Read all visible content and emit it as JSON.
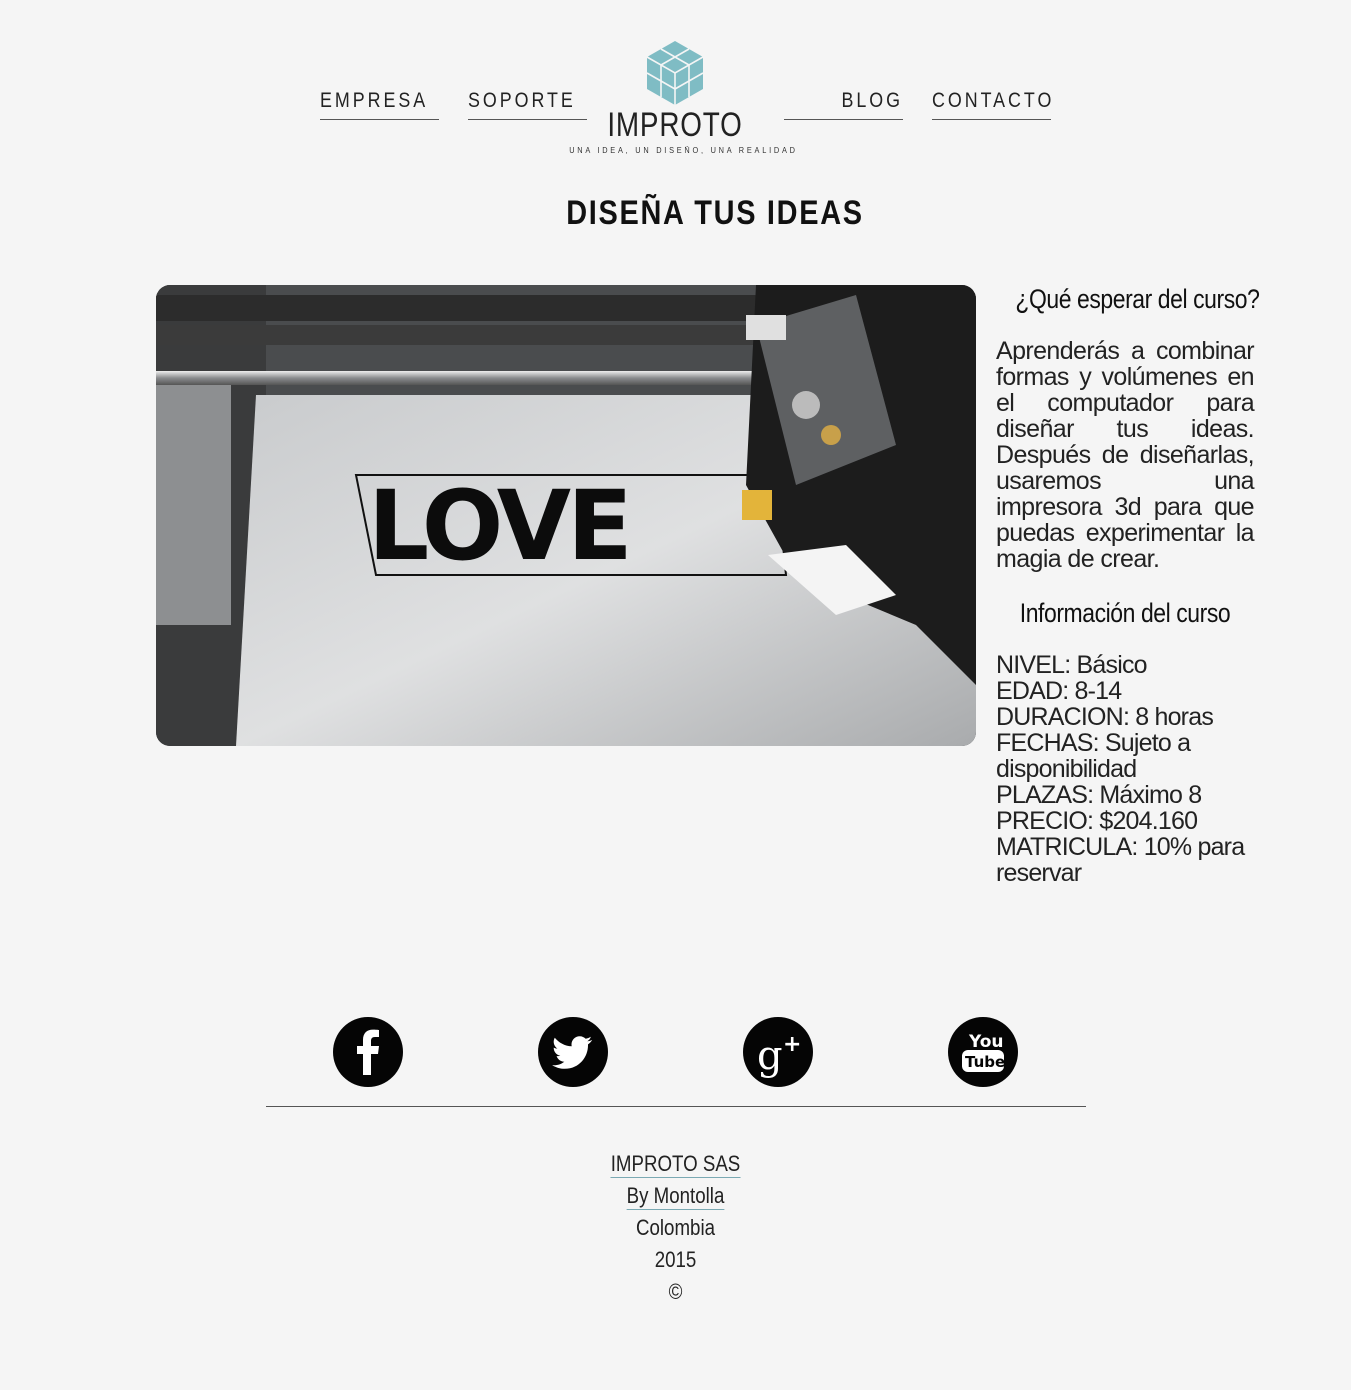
{
  "nav": {
    "empresa": "EMPRESA",
    "soporte": "SOPORTE",
    "blog": "BLOG",
    "contacto": "CONTACTO"
  },
  "logo": {
    "name": "IMPROTO",
    "tagline": "UNA IDEA, UN DISEÑO, UNA REALIDAD",
    "color": "#7fbcc4"
  },
  "page_title": "DISEÑA TUS IDEAS",
  "photo": {
    "subject": "LOVE"
  },
  "sidebar": {
    "expect_title": "¿Qué esperar del curso?",
    "expect_text": "Aprenderás a combinar formas y volúmenes en el computador para diseñar tus ideas. Después de diseñarlas, usaremos una impresora 3d para que puedas experimentar la magia de crear.",
    "info_title": "Información del curso",
    "info_items": [
      "NIVEL: Básico",
      "EDAD: 8-14",
      "DURACION: 8 horas",
      "FECHAS: Sujeto a disponibilidad",
      "PLAZAS: Máximo 8",
      "PRECIO: $204.160",
      "MATRICULA: 10% para reservar"
    ]
  },
  "social": {
    "facebook": "facebook-icon",
    "twitter": "twitter-icon",
    "gplus": "google-plus-icon",
    "youtube": "youtube-icon",
    "youtube_label_top": "You",
    "youtube_label_bottom": "Tube"
  },
  "footer": {
    "company": "IMPROTO SAS",
    "author": "By Montolla",
    "country": "Colombia",
    "year": "2015",
    "copyright": "©"
  }
}
